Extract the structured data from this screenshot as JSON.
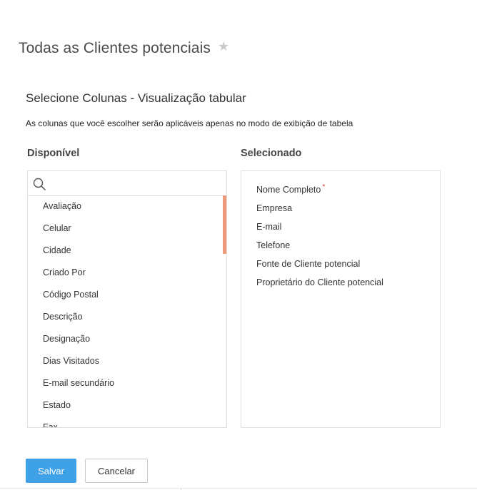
{
  "header": {
    "title": "Todas as Clientes potenciais",
    "star_icon": "star-icon"
  },
  "dialog": {
    "title": "Selecione Colunas - Visualização tabular",
    "description": "As colunas que você escolher serão aplicáveis apenas no modo de exibição de tabela"
  },
  "available": {
    "header": "Disponível",
    "search_placeholder": "",
    "items": [
      "Avaliação",
      "Celular",
      "Cidade",
      "Criado Por",
      "Código Postal",
      "Descrição",
      "Designação",
      "Dias Visitados",
      "E-mail secundário",
      "Estado",
      "Fax"
    ]
  },
  "selected": {
    "header": "Selecionado",
    "items": [
      {
        "label": "Nome Completo",
        "required": "*"
      },
      {
        "label": "Empresa"
      },
      {
        "label": "E-mail"
      },
      {
        "label": "Telefone"
      },
      {
        "label": "Fonte de Cliente potencial"
      },
      {
        "label": "Proprietário do Cliente potencial"
      }
    ]
  },
  "buttons": {
    "save": "Salvar",
    "cancel": "Cancelar"
  },
  "colors": {
    "accent": "#3fa1e8",
    "scroll_thumb": "#ef9a7a",
    "required": "#e0382f"
  }
}
